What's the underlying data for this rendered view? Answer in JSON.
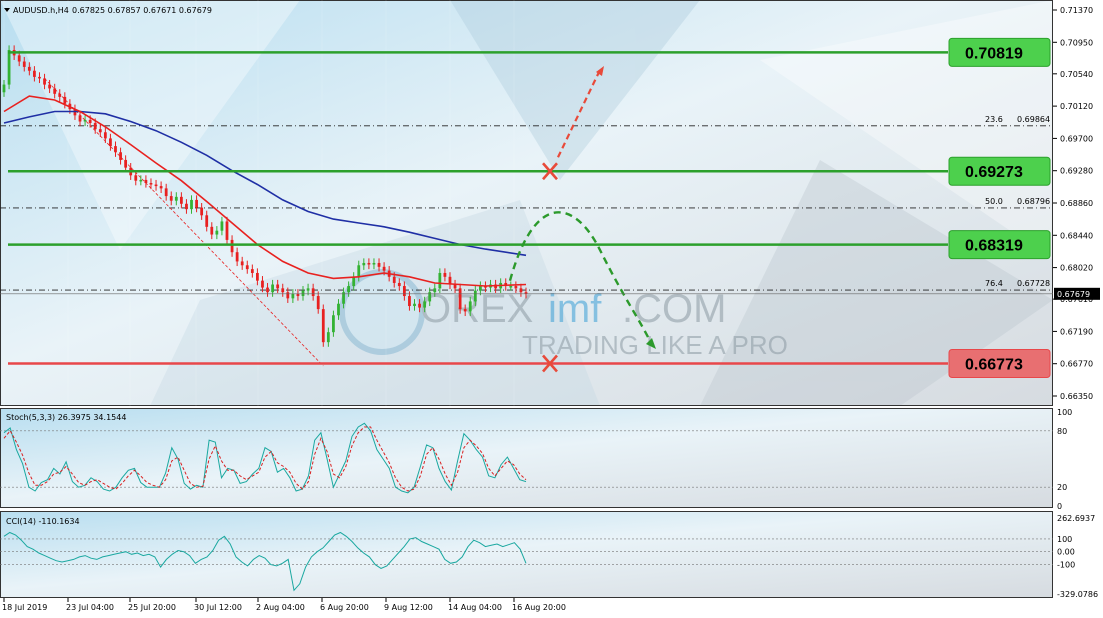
{
  "header": {
    "symbol": "AUDUSD.h,H4",
    "ohlc": "0.67825 0.67857 0.67671 0.67679"
  },
  "watermark": {
    "brand_left": "OREX",
    "brand_mid": "imf",
    "brand_right": ".COM",
    "tagline": "TRADING LIKE A PRO"
  },
  "colors": {
    "support_resistance_green": "#2ca02c",
    "support_red": "#e8474a",
    "ma_fast": "#e8211f",
    "ma_slow": "#1f2fa5",
    "candle_bull": "#33b233",
    "candle_bear": "#e82020",
    "forecast_up": "#e84a3a",
    "forecast_curve": "#2c9a2c",
    "stoch_main": "#1aa8a0",
    "stoch_signal": "#d92020",
    "cci_line": "#1aa8a0"
  },
  "chart_data": [
    {
      "type": "candlestick",
      "panel": "main",
      "title": "AUDUSD.h,H4",
      "ylim": [
        0.6635,
        0.7137
      ],
      "y_ticks": [
        "0.71370",
        "0.70950",
        "0.70540",
        "0.70120",
        "0.69700",
        "0.69280",
        "0.68860",
        "0.68440",
        "0.68020",
        "0.67610",
        "0.67190",
        "0.66770",
        "0.66350"
      ],
      "x_ticks": [
        "18 Jul 2019",
        "23 Jul 04:00",
        "25 Jul 20:00",
        "30 Jul 12:00",
        "2 Aug 04:00",
        "6 Aug 20:00",
        "9 Aug 12:00",
        "14 Aug 04:00",
        "16 Aug 20:00"
      ],
      "current_price": "0.67679",
      "levels": [
        {
          "value": 0.70819,
          "label": "0.70819",
          "color": "green"
        },
        {
          "value": 0.69273,
          "label": "0.69273",
          "color": "green"
        },
        {
          "value": 0.68319,
          "label": "0.68319",
          "color": "green"
        },
        {
          "value": 0.66773,
          "label": "0.66773",
          "color": "red"
        }
      ],
      "fibonacci": [
        {
          "ratio": "23.6",
          "value": 0.69864,
          "label": "0.69864"
        },
        {
          "ratio": "50.0",
          "value": 0.68796,
          "label": "0.68796"
        },
        {
          "ratio": "76.4",
          "value": 0.67728,
          "label": "0.67728"
        }
      ],
      "close_path": [
        [
          0,
          0.704
        ],
        [
          1,
          0.7085
        ],
        [
          2,
          0.7078
        ],
        [
          3,
          0.707
        ],
        [
          4,
          0.7063
        ],
        [
          5,
          0.7058
        ],
        [
          6,
          0.705
        ],
        [
          7,
          0.7048
        ],
        [
          8,
          0.704
        ],
        [
          9,
          0.7035
        ],
        [
          10,
          0.7028
        ],
        [
          11,
          0.7024
        ],
        [
          12,
          0.7015
        ],
        [
          13,
          0.7008
        ],
        [
          14,
          0.7
        ],
        [
          15,
          0.6992
        ],
        [
          16,
          0.6994
        ],
        [
          17,
          0.699
        ],
        [
          18,
          0.6982
        ],
        [
          19,
          0.6978
        ],
        [
          20,
          0.697
        ],
        [
          21,
          0.696
        ],
        [
          22,
          0.6952
        ],
        [
          23,
          0.6942
        ],
        [
          24,
          0.6932
        ],
        [
          25,
          0.6922
        ],
        [
          26,
          0.6915
        ],
        [
          27,
          0.6916
        ],
        [
          28,
          0.6912
        ],
        [
          29,
          0.691
        ],
        [
          30,
          0.6908
        ],
        [
          31,
          0.6905
        ],
        [
          32,
          0.6895
        ],
        [
          33,
          0.6889
        ],
        [
          34,
          0.6894
        ],
        [
          35,
          0.6885
        ],
        [
          36,
          0.6878
        ],
        [
          37,
          0.689
        ],
        [
          38,
          0.688
        ],
        [
          39,
          0.687
        ],
        [
          40,
          0.6855
        ],
        [
          41,
          0.6845
        ],
        [
          42,
          0.685
        ],
        [
          43,
          0.6862
        ],
        [
          44,
          0.6838
        ],
        [
          45,
          0.6822
        ],
        [
          46,
          0.681
        ],
        [
          47,
          0.6805
        ],
        [
          48,
          0.68
        ],
        [
          49,
          0.6795
        ],
        [
          50,
          0.6785
        ],
        [
          51,
          0.6776
        ],
        [
          52,
          0.677
        ],
        [
          53,
          0.678
        ],
        [
          54,
          0.6775
        ],
        [
          55,
          0.677
        ],
        [
          56,
          0.6762
        ],
        [
          57,
          0.6768
        ],
        [
          58,
          0.6765
        ],
        [
          59,
          0.6772
        ],
        [
          60,
          0.6775
        ],
        [
          61,
          0.6765
        ],
        [
          62,
          0.6748
        ],
        [
          63,
          0.6705
        ],
        [
          64,
          0.6718
        ],
        [
          65,
          0.674
        ],
        [
          66,
          0.6755
        ],
        [
          67,
          0.677
        ],
        [
          68,
          0.6778
        ],
        [
          69,
          0.679
        ],
        [
          70,
          0.6805
        ],
        [
          71,
          0.6808
        ],
        [
          72,
          0.6806
        ],
        [
          73,
          0.6808
        ],
        [
          74,
          0.6803
        ],
        [
          75,
          0.6798
        ],
        [
          76,
          0.679
        ],
        [
          77,
          0.6782
        ],
        [
          78,
          0.6778
        ],
        [
          79,
          0.6765
        ],
        [
          80,
          0.6752
        ],
        [
          81,
          0.6755
        ],
        [
          82,
          0.675
        ],
        [
          83,
          0.6758
        ],
        [
          84,
          0.677
        ],
        [
          85,
          0.6775
        ],
        [
          86,
          0.6795
        ],
        [
          87,
          0.679
        ],
        [
          88,
          0.678
        ],
        [
          89,
          0.6775
        ],
        [
          90,
          0.6748
        ],
        [
          91,
          0.6745
        ],
        [
          92,
          0.6758
        ],
        [
          93,
          0.6772
        ],
        [
          94,
          0.6778
        ],
        [
          95,
          0.6776
        ],
        [
          96,
          0.678
        ],
        [
          97,
          0.6775
        ],
        [
          98,
          0.6782
        ],
        [
          99,
          0.6778
        ],
        [
          100,
          0.6778
        ],
        [
          101,
          0.6775
        ],
        [
          102,
          0.677
        ],
        [
          103,
          0.6768
        ]
      ],
      "ma_fast": [
        [
          0,
          0.7005
        ],
        [
          5,
          0.7025
        ],
        [
          10,
          0.702
        ],
        [
          15,
          0.7005
        ],
        [
          20,
          0.6985
        ],
        [
          25,
          0.6962
        ],
        [
          30,
          0.6938
        ],
        [
          35,
          0.6915
        ],
        [
          40,
          0.6888
        ],
        [
          45,
          0.686
        ],
        [
          50,
          0.6832
        ],
        [
          55,
          0.681
        ],
        [
          60,
          0.6795
        ],
        [
          65,
          0.6788
        ],
        [
          70,
          0.679
        ],
        [
          75,
          0.6795
        ],
        [
          80,
          0.679
        ],
        [
          85,
          0.6782
        ],
        [
          90,
          0.678
        ],
        [
          95,
          0.6778
        ],
        [
          103,
          0.678
        ]
      ],
      "ma_slow": [
        [
          0,
          0.699
        ],
        [
          5,
          0.6998
        ],
        [
          10,
          0.7005
        ],
        [
          15,
          0.7005
        ],
        [
          20,
          0.7002
        ],
        [
          25,
          0.6992
        ],
        [
          30,
          0.698
        ],
        [
          35,
          0.6965
        ],
        [
          40,
          0.6948
        ],
        [
          45,
          0.6928
        ],
        [
          50,
          0.691
        ],
        [
          55,
          0.689
        ],
        [
          60,
          0.6875
        ],
        [
          65,
          0.6865
        ],
        [
          70,
          0.686
        ],
        [
          75,
          0.6855
        ],
        [
          80,
          0.6848
        ],
        [
          85,
          0.684
        ],
        [
          90,
          0.6832
        ],
        [
          95,
          0.6826
        ],
        [
          103,
          0.6818
        ]
      ]
    },
    {
      "type": "line",
      "panel": "stochastic",
      "title": "Stoch(5,3,3) 26.3975 34.1544",
      "ylim": [
        0,
        100
      ],
      "y_ticks": [
        "100",
        "80",
        "20",
        "0"
      ],
      "series": [
        {
          "name": "main",
          "values": [
            78,
            83,
            60,
            45,
            20,
            16,
            25,
            28,
            40,
            34,
            47,
            26,
            20,
            22,
            30,
            26,
            18,
            16,
            20,
            30,
            38,
            40,
            25,
            20,
            20,
            20,
            35,
            62,
            50,
            24,
            18,
            22,
            20,
            70,
            68,
            30,
            40,
            38,
            24,
            26,
            34,
            40,
            62,
            58,
            36,
            40,
            30,
            16,
            18,
            32,
            70,
            78,
            50,
            20,
            34,
            48,
            74,
            84,
            88,
            80,
            60,
            50,
            40,
            20,
            16,
            14,
            20,
            42,
            65,
            62,
            40,
            26,
            17,
            48,
            77,
            70,
            60,
            52,
            32,
            30,
            44,
            52,
            40,
            28,
            26
          ]
        },
        {
          "name": "signal",
          "values": [
            72,
            80,
            68,
            54,
            35,
            22,
            22,
            26,
            34,
            36,
            42,
            34,
            25,
            22,
            26,
            28,
            24,
            20,
            18,
            24,
            32,
            38,
            32,
            25,
            22,
            20,
            28,
            48,
            52,
            38,
            24,
            20,
            21,
            50,
            64,
            48,
            38,
            38,
            32,
            28,
            32,
            36,
            52,
            58,
            46,
            42,
            36,
            24,
            18,
            26,
            55,
            72,
            58,
            34,
            30,
            42,
            64,
            78,
            84,
            84,
            70,
            58,
            46,
            30,
            20,
            16,
            18,
            32,
            55,
            62,
            50,
            34,
            22,
            36,
            62,
            70,
            64,
            56,
            40,
            32,
            40,
            48,
            44,
            34,
            28
          ]
        }
      ]
    },
    {
      "type": "line",
      "panel": "cci",
      "title": "CCI(14) -110.1634",
      "ylim": [
        -329.0786,
        262.6937
      ],
      "y_ticks": [
        "262.6937",
        "100",
        "0.00",
        "-100",
        "-329.0786"
      ],
      "series": [
        {
          "name": "CCI(14)",
          "values": [
            120,
            150,
            130,
            90,
            40,
            20,
            -10,
            -30,
            -50,
            -70,
            -80,
            -70,
            -60,
            -40,
            -30,
            -50,
            -60,
            -40,
            -30,
            -20,
            -10,
            0,
            -20,
            -10,
            -30,
            -20,
            -40,
            -120,
            -60,
            -20,
            10,
            0,
            -30,
            -90,
            -60,
            -40,
            10,
            90,
            120,
            60,
            -40,
            -80,
            -110,
            -60,
            -30,
            -50,
            -100,
            -110,
            -90,
            -60,
            -300,
            -250,
            -120,
            -40,
            0,
            30,
            80,
            130,
            150,
            120,
            80,
            30,
            -10,
            -40,
            -100,
            -130,
            -110,
            -60,
            -10,
            40,
            100,
            110,
            80,
            60,
            40,
            20,
            -60,
            -90,
            -80,
            -40,
            40,
            90,
            70,
            40,
            50,
            60,
            40,
            55,
            70,
            20,
            -90
          ]
        }
      ]
    }
  ]
}
